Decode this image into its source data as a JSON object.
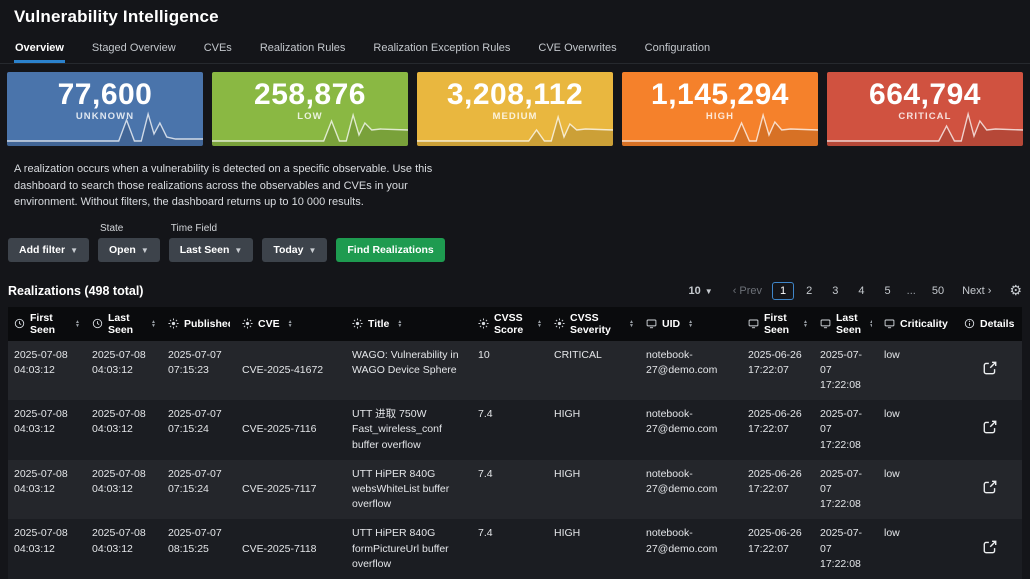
{
  "page": {
    "title": "Vulnerability Intelligence"
  },
  "tabs": [
    {
      "label": "Overview"
    },
    {
      "label": "Staged Overview"
    },
    {
      "label": "CVEs"
    },
    {
      "label": "Realization Rules"
    },
    {
      "label": "Realization Exception Rules"
    },
    {
      "label": "CVE Overwrites"
    },
    {
      "label": "Configuration"
    }
  ],
  "cards": [
    {
      "value": "77,600",
      "label": "UNKNOWN",
      "color": "#4a74ab"
    },
    {
      "value": "258,876",
      "label": "LOW",
      "color": "#8ab843"
    },
    {
      "value": "3,208,112",
      "label": "MEDIUM",
      "color": "#e9b73f"
    },
    {
      "value": "1,145,294",
      "label": "HIGH",
      "color": "#f5812b"
    },
    {
      "value": "664,794",
      "label": "CRITICAL",
      "color": "#d05240"
    }
  ],
  "description": "A realization occurs when a vulnerability is detected on a specific observable. Use this dashboard to search those realizations across the observables and CVEs in your environment. Without filters, the dashboard returns up to 10 000 results.",
  "filters": {
    "add_filter": "Add filter",
    "state_label": "State",
    "state_value": "Open",
    "time_field_label": "Time Field",
    "time_field_value": "Last Seen",
    "time_range": "Today",
    "find_button": "Find Realizations"
  },
  "section": {
    "title": "Realizations (498 total)"
  },
  "pagination": {
    "page_size": "10",
    "prev": "‹ Prev",
    "pages": [
      "1",
      "2",
      "3",
      "4",
      "5",
      "...",
      "50"
    ],
    "next": "Next ›"
  },
  "table": {
    "columns": [
      {
        "label": "First Seen",
        "icon": "clock-icon"
      },
      {
        "label": "Last Seen",
        "icon": "clock-icon"
      },
      {
        "label": "Published",
        "icon": "sun-icon"
      },
      {
        "label": "CVE",
        "icon": "sun-icon"
      },
      {
        "label": "Title",
        "icon": "sun-icon"
      },
      {
        "label": "CVSS Score",
        "icon": "sun-icon"
      },
      {
        "label": "CVSS Severity",
        "icon": "sun-icon"
      },
      {
        "label": "UID",
        "icon": "monitor-icon"
      },
      {
        "label": "First Seen",
        "icon": "monitor-icon"
      },
      {
        "label": "Last Seen",
        "icon": "monitor-icon"
      },
      {
        "label": "Criticality",
        "icon": "monitor-icon"
      },
      {
        "label": "Details",
        "icon": "info-icon"
      }
    ],
    "rows": [
      {
        "first_seen": "2025-07-08\n04:03:12",
        "last_seen": "2025-07-08\n04:03:12",
        "published": "2025-07-07\n07:15:23",
        "cve": "CVE-2025-41672",
        "title": "WAGO: Vulnerability in WAGO Device Sphere",
        "cvss_score": "10",
        "cvss_severity": "CRITICAL",
        "uid": "notebook-27@demo.com",
        "obs_first_seen": "2025-06-26\n17:22:07",
        "obs_last_seen": "2025-07-07\n17:22:08",
        "criticality": "low"
      },
      {
        "first_seen": "2025-07-08\n04:03:12",
        "last_seen": "2025-07-08\n04:03:12",
        "published": "2025-07-07\n07:15:24",
        "cve": "CVE-2025-7116",
        "title": "UTT 进取 750W Fast_wireless_conf buffer overflow",
        "cvss_score": "7.4",
        "cvss_severity": "HIGH",
        "uid": "notebook-27@demo.com",
        "obs_first_seen": "2025-06-26\n17:22:07",
        "obs_last_seen": "2025-07-07\n17:22:08",
        "criticality": "low"
      },
      {
        "first_seen": "2025-07-08\n04:03:12",
        "last_seen": "2025-07-08\n04:03:12",
        "published": "2025-07-07\n07:15:24",
        "cve": "CVE-2025-7117",
        "title": "UTT HiPER 840G websWhiteList buffer overflow",
        "cvss_score": "7.4",
        "cvss_severity": "HIGH",
        "uid": "notebook-27@demo.com",
        "obs_first_seen": "2025-06-26\n17:22:07",
        "obs_last_seen": "2025-07-07\n17:22:08",
        "criticality": "low"
      },
      {
        "first_seen": "2025-07-08\n04:03:12",
        "last_seen": "2025-07-08\n04:03:12",
        "published": "2025-07-07\n08:15:25",
        "cve": "CVE-2025-7118",
        "title": "UTT HiPER 840G formPictureUrl buffer overflow",
        "cvss_score": "7.4",
        "cvss_severity": "HIGH",
        "uid": "notebook-27@demo.com",
        "obs_first_seen": "2025-06-26\n17:22:07",
        "obs_last_seen": "2025-07-07\n17:22:08",
        "criticality": "low"
      }
    ]
  },
  "colors": {
    "accent": "#2b82cd",
    "find_button_green": "#1e9b50",
    "page_background": "#141519",
    "table_header_background": "#0a0b0d"
  }
}
